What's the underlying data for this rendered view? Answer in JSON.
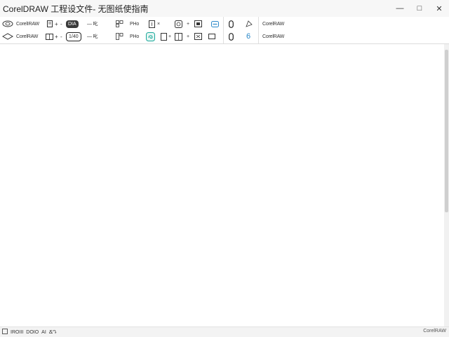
{
  "window": {
    "title": "CorelDRAW 工程设文件- 无图纸使指南",
    "minimize_label": "—",
    "maximize_label": "□",
    "close_label": "✕"
  },
  "ribbon": {
    "row1": {
      "node_label": "CorelIRAW",
      "pill_dark": "DIA",
      "text_a": "— 叱",
      "text_b": "PHo",
      "text_c": "Ö",
      "right_label": "CorelRAW"
    },
    "row2": {
      "node_label": "CorelRAW",
      "pill_outline": "1/40",
      "text_a": "— 叱",
      "text_b": "PHo",
      "text_c": "6",
      "right_label": "CorelRAW"
    }
  },
  "statusbar": {
    "items": [
      "IROIII",
      "DOIO",
      "AI",
      "ՃԴ"
    ],
    "right_text": "CorelRAW"
  },
  "colors": {
    "accent_teal": "#18a89a",
    "accent_blue": "#2a88c9"
  }
}
